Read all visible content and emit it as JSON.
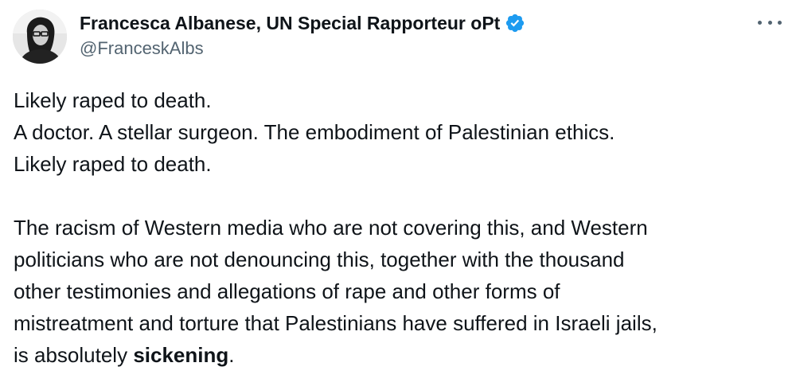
{
  "author": {
    "display_name": "Francesca Albanese, UN Special Rapporteur oPt",
    "handle": "@FranceskAlbs",
    "verified_color": "#1d9bf0",
    "avatar_icon": "profile-photo"
  },
  "menu": {
    "more_icon": "more-horizontal-icon"
  },
  "tweet": {
    "lines_block1": [
      "Likely raped to death.",
      "A doctor. A stellar surgeon. The embodiment of Palestinian ethics.",
      "Likely raped to death."
    ],
    "lines_block2": [
      "The racism of Western media who are not covering this, and Western",
      "politicians who are not denouncing this, together with the thousand",
      "other testimonies and allegations of rape and other forms of",
      "mistreatment and torture that Palestinians have suffered in Israeli jails,"
    ],
    "last_line_prefix": "is absolutely ",
    "last_line_bold": "sickening",
    "last_line_suffix": "."
  }
}
